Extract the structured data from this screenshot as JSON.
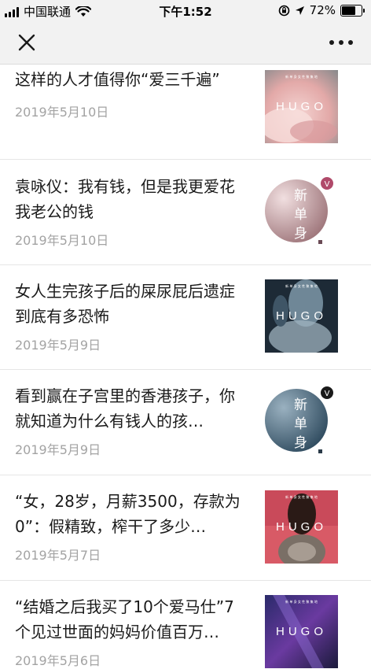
{
  "status_bar": {
    "carrier": "中国联通",
    "time": "下午1:52",
    "battery_percent": "72%",
    "battery_level": 0.72,
    "icons": [
      "signal-icon",
      "wifi-icon",
      "rotation-lock-icon",
      "location-icon",
      "battery-icon"
    ]
  },
  "nav": {
    "close_icon": "close-icon",
    "more_icon": "more-icon"
  },
  "brand_text": {
    "hugo": "HUGO",
    "hugo_header": "新 单 身 女 性 聚 集 地",
    "logo_chars": [
      "新",
      "单",
      "身"
    ],
    "logo_badge": "V"
  },
  "articles": [
    {
      "title": "这样的人才值得你“爱三千遍”",
      "date": "2019年5月10日",
      "thumb": "hugo-pink-flower"
    },
    {
      "title": "袁咏仪：我有钱，但是我更爱花我老公的钱",
      "date": "2019年5月10日",
      "thumb": "logo-pink"
    },
    {
      "title": "女人生完孩子后的屎尿屁后遗症到底有多恐怖",
      "date": "2019年5月9日",
      "thumb": "hugo-blue-portrait"
    },
    {
      "title": "看到赢在子宫里的香港孩子，你就知道为什么有钱人的孩…",
      "date": "2019年5月9日",
      "thumb": "logo-blue"
    },
    {
      "title": "“女，28岁，月薪3500，存款为0”：假精致，榨干了多少…",
      "date": "2019年5月7日",
      "thumb": "hugo-red-portrait"
    },
    {
      "title": "“结婚之后我买了10个爱马仕”7个见过世面的妈妈价值百万…",
      "date": "2019年5月6日",
      "thumb": "hugo-purple"
    }
  ],
  "colors": {
    "bar_background": "#f2f2f2",
    "date_gray": "#a3a3a3",
    "logo_pink": "#c9a4a8",
    "logo_blue": "#4a6a80",
    "badge_pink": "#b04a6a"
  }
}
